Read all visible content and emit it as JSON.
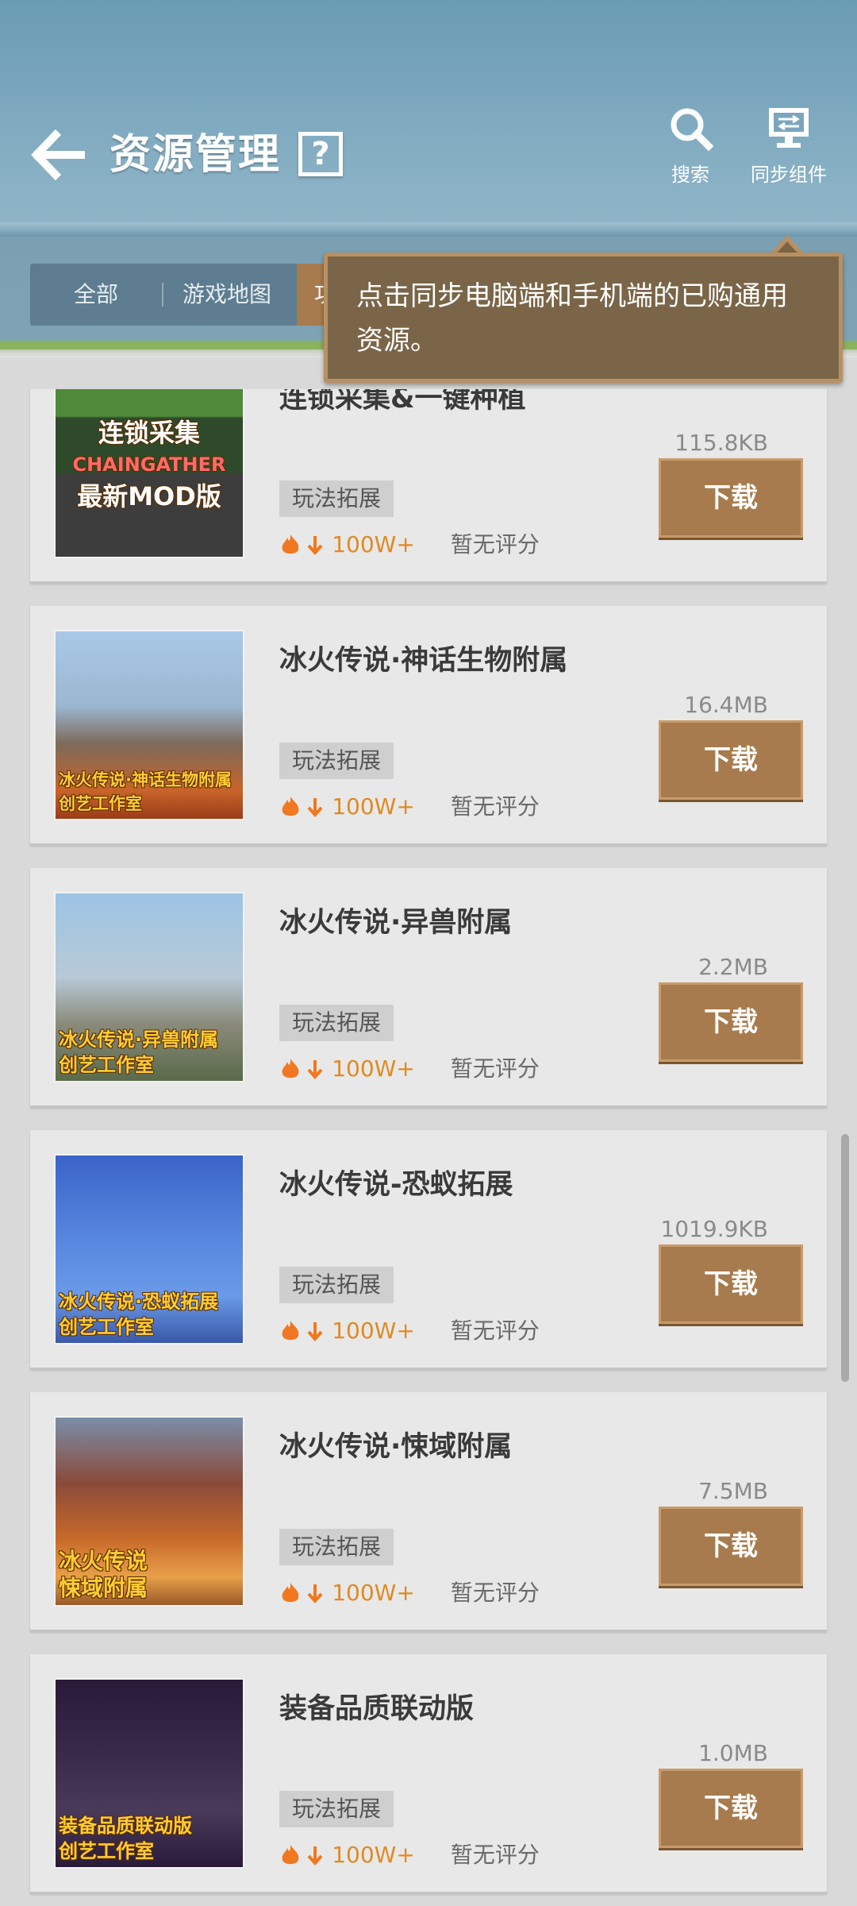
{
  "header": {
    "title": "资源管理",
    "help_label": "?",
    "search_label": "搜索",
    "sync_label": "同步组件"
  },
  "tabs": {
    "all": "全部",
    "maps": "游戏地图",
    "func": "功能"
  },
  "tooltip": {
    "line1": "点击同步电脑端和手机端的已购通用",
    "line2": "资源。"
  },
  "items": [
    {
      "name": "连锁采集&一键种植",
      "size": "115.8KB",
      "tag": "玩法拓展",
      "downloads": "100W+",
      "rating": "暂无评分",
      "button": "下载",
      "thumb_lines": [
        "连锁采集",
        "CHAINGATHER",
        "最新MOD版"
      ]
    },
    {
      "name": "冰火传说·神话生物附属",
      "size": "16.4MB",
      "tag": "玩法拓展",
      "downloads": "100W+",
      "rating": "暂无评分",
      "button": "下载",
      "thumb_lines": [
        "冰火传说·神话生物附属",
        "创艺工作室"
      ]
    },
    {
      "name": "冰火传说·异兽附属",
      "size": "2.2MB",
      "tag": "玩法拓展",
      "downloads": "100W+",
      "rating": "暂无评分",
      "button": "下载",
      "thumb_lines": [
        "冰火传说·异兽附属",
        "创艺工作室"
      ]
    },
    {
      "name": "冰火传说-恐蚁拓展",
      "size": "1019.9KB",
      "tag": "玩法拓展",
      "downloads": "100W+",
      "rating": "暂无评分",
      "button": "下载",
      "thumb_lines": [
        "冰火传说·恐蚁拓展",
        "创艺工作室"
      ]
    },
    {
      "name": "冰火传说·悚域附属",
      "size": "7.5MB",
      "tag": "玩法拓展",
      "downloads": "100W+",
      "rating": "暂无评分",
      "button": "下载",
      "thumb_lines": [
        "冰火传说",
        "悚域附属"
      ]
    },
    {
      "name": "装备品质联动版",
      "size": "1.0MB",
      "tag": "玩法拓展",
      "downloads": "100W+",
      "rating": "暂无评分",
      "button": "下载",
      "thumb_lines": [
        "装备品质联动版",
        "创艺工作室"
      ]
    }
  ],
  "colors": {
    "accent_brown": "#a77b4d",
    "download_orange": "#e08a22",
    "header_blue": "#7aa6bd"
  }
}
